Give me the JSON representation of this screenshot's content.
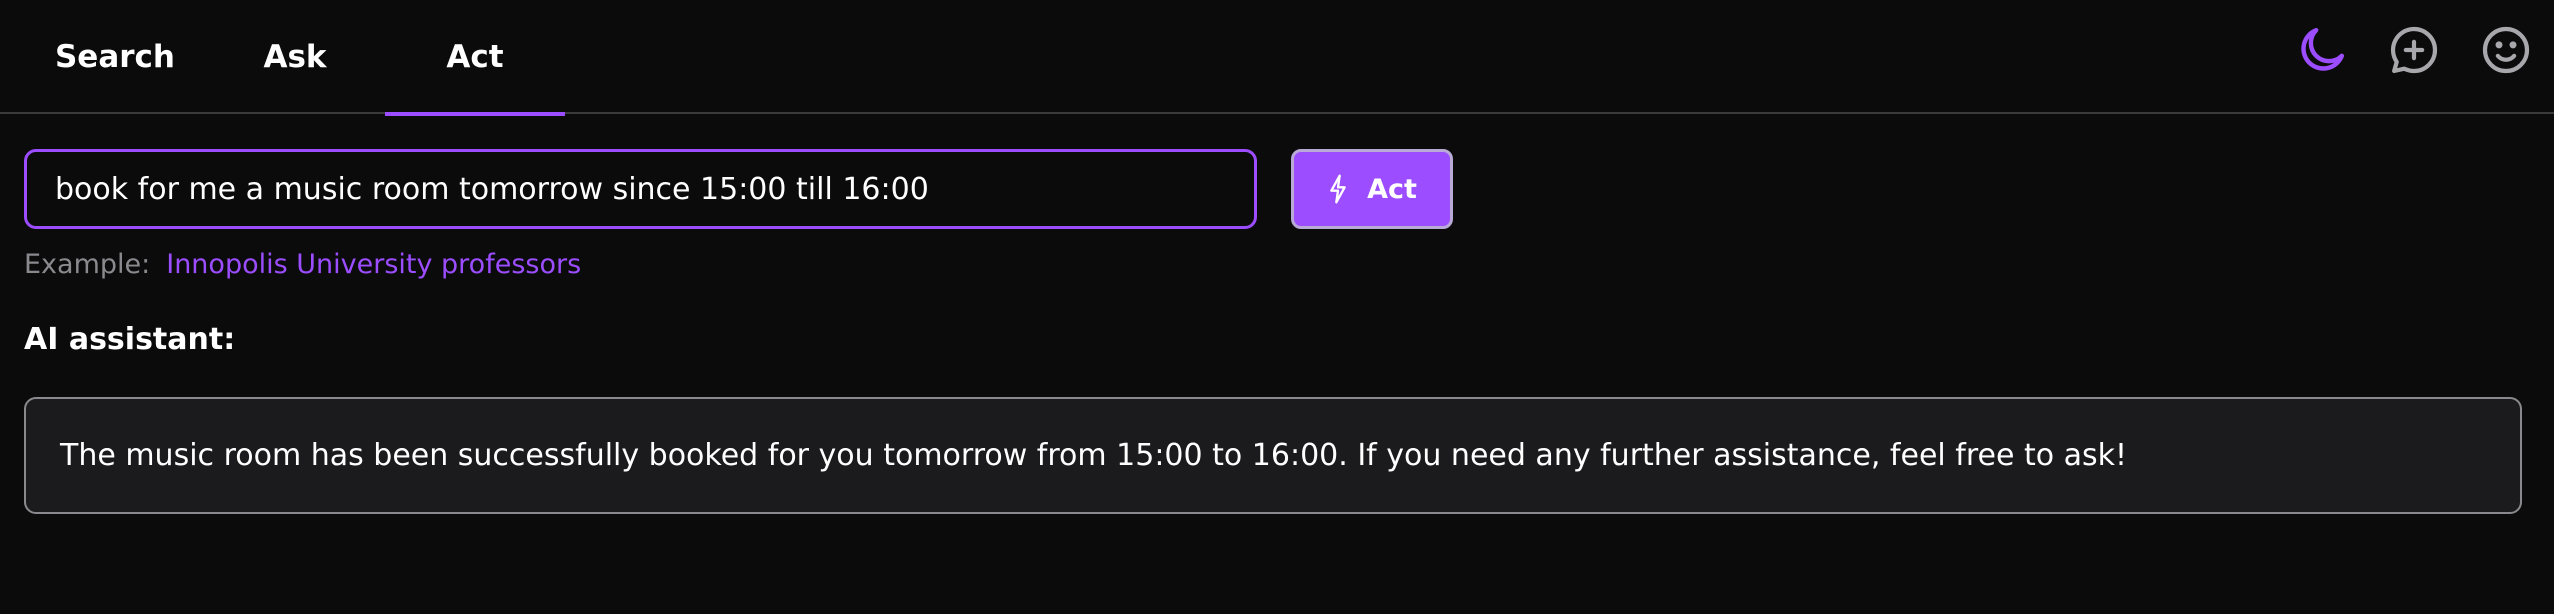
{
  "header": {
    "tabs": [
      {
        "label": "Search",
        "active": false
      },
      {
        "label": "Ask",
        "active": false
      },
      {
        "label": "Act",
        "active": true
      }
    ],
    "icons": [
      "moon-icon",
      "chat-plus-icon",
      "smiley-icon"
    ],
    "accent_color": "#9b4dff"
  },
  "main": {
    "input_value": "book for me a music room tomorrow since 15:00 till 16:00",
    "act_button_label": "Act",
    "act_button_icon": "lightning-icon",
    "example_label": "Example:",
    "example_link": "Innopolis University professors",
    "assistant_heading": "AI assistant:",
    "assistant_response": "The music room has been successfully booked for you tomorrow from 15:00 to 16:00. If you need any further assistance, feel free to ask!"
  }
}
